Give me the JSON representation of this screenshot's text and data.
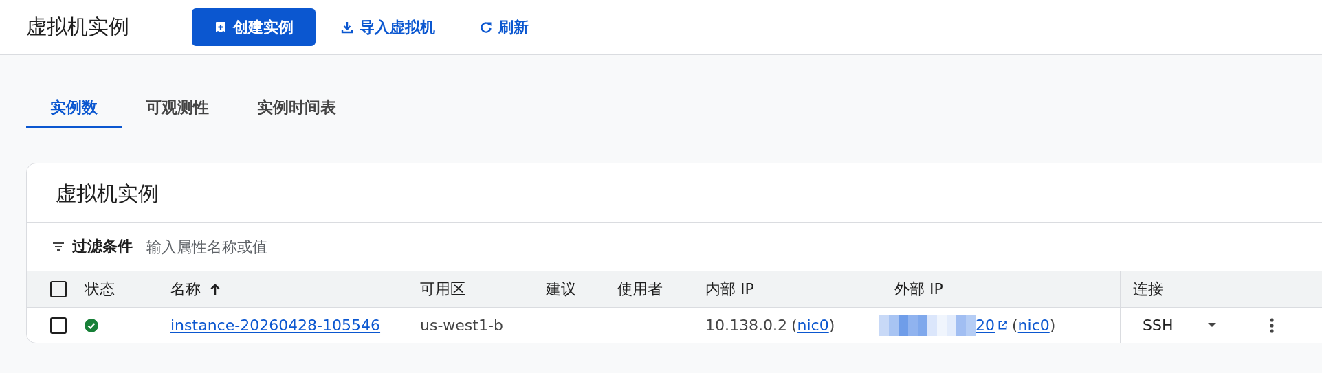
{
  "header": {
    "title": "虚拟机实例",
    "actions": [
      {
        "kind": "primary",
        "label": "创建实例"
      },
      {
        "kind": "import",
        "label": "导入虚拟机"
      },
      {
        "kind": "refresh",
        "label": "刷新"
      }
    ]
  },
  "tabs": [
    {
      "label": "实例数",
      "selected": true
    },
    {
      "label": "可观测性",
      "selected": false
    },
    {
      "label": "实例时间表",
      "selected": false
    }
  ],
  "card": {
    "title": "虚拟机实例",
    "filter": {
      "label": "过滤条件",
      "placeholder": "输入属性名称或值"
    }
  },
  "table": {
    "columns": [
      {
        "label": "状态"
      },
      {
        "label": "名称",
        "sorted_ascending": true
      },
      {
        "label": "可用区"
      },
      {
        "label": "建议"
      },
      {
        "label": "使用者"
      },
      {
        "label": "内部 IP"
      },
      {
        "label": "外部 IP"
      },
      {
        "label": "连接"
      }
    ],
    "select_all_checked": false,
    "rows": [
      {
        "checked": false,
        "status_ok": true,
        "name": "instance-20260428-105546",
        "zone": "us-west1-b",
        "internal_ip": "10.138.0.2",
        "internal_open": "(",
        "internal_nic": "nic0",
        "internal_close": ")",
        "external_ip": "20",
        "external_open": "(",
        "external_nic": "nic0",
        "external_close": ")",
        "connect": "SSH"
      }
    ]
  }
}
